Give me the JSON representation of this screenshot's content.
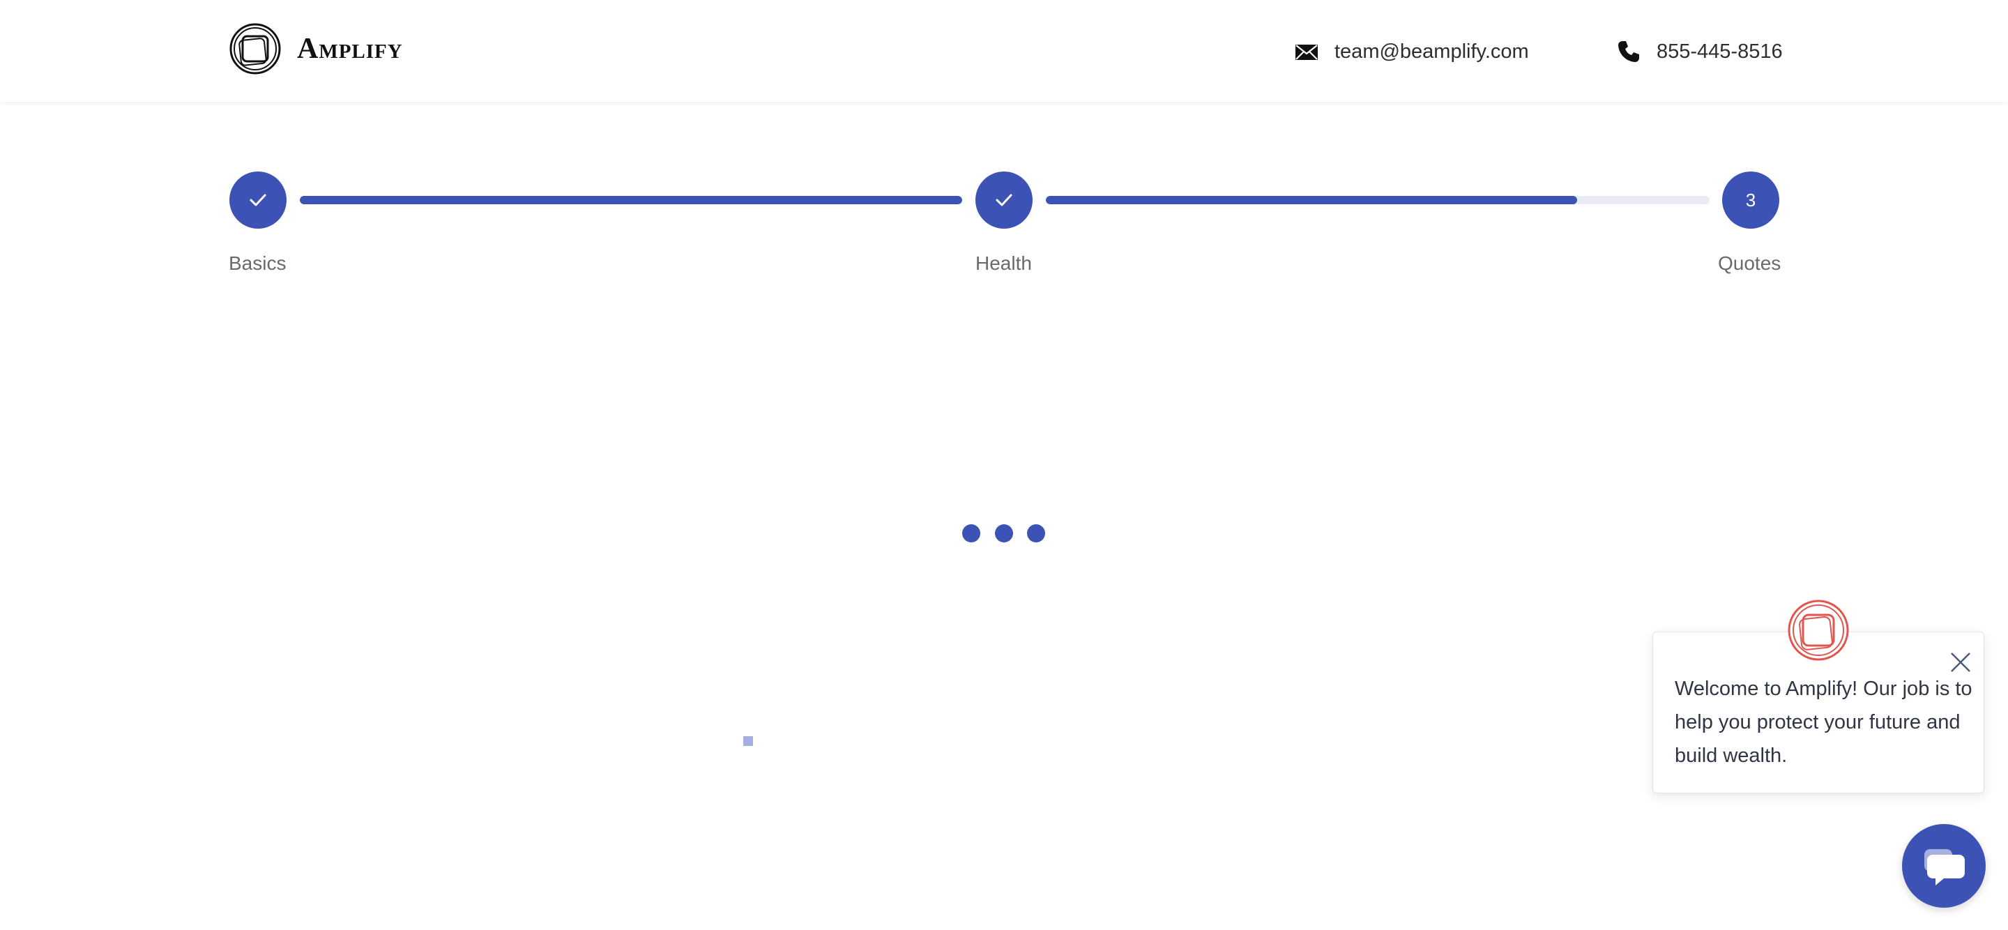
{
  "header": {
    "brand": "Amplify",
    "email": "team@beamplify.com",
    "phone": "855-445-8516"
  },
  "stepper": {
    "steps": [
      {
        "label": "Basics",
        "status": "complete"
      },
      {
        "label": "Health",
        "status": "complete"
      },
      {
        "label": "Quotes",
        "status": "current",
        "number": "3"
      }
    ],
    "segments": [
      {
        "progress_percent": 100
      },
      {
        "progress_percent": 80
      }
    ]
  },
  "loader": {
    "dot_count": 3
  },
  "chat": {
    "message": "Welcome to Amplify! Our job is to help you protect your future and build wealth.",
    "avatar_icon": "amplify-logo-icon",
    "close_icon": "close-icon",
    "launcher_icon": "chat-bubble-icon"
  },
  "colors": {
    "accent": "#3d52b5",
    "track_bg": "#e9ebf3",
    "chat_logo": "#e0564f"
  }
}
